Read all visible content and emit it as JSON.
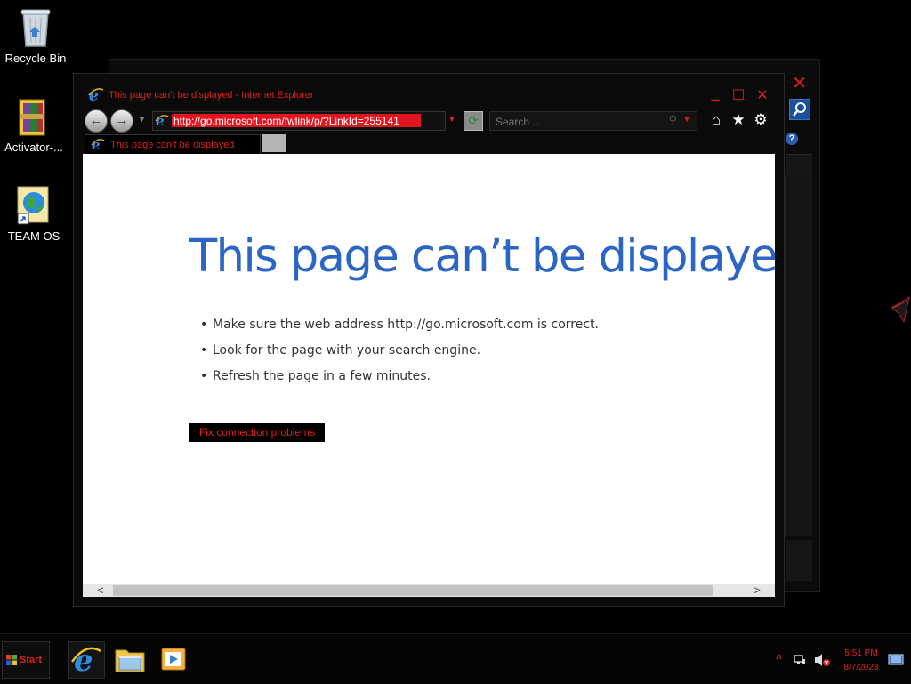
{
  "desktop": {
    "icons": [
      {
        "label": "Recycle Bin",
        "icon": "recycle-bin-icon"
      },
      {
        "label": "Activator-...",
        "icon": "winrar-archive-icon"
      },
      {
        "label": "TEAM OS",
        "icon": "globe-shortcut-icon"
      }
    ]
  },
  "browser": {
    "window_title": "This page can’t be displayed - Internet Explorer",
    "address": "http://go.microsoft.com/fwlink/p/?LinkId=255141",
    "search_placeholder": "Search ...",
    "tab_title": "This page can’t be displayed",
    "controls": {
      "minimize": "_",
      "maximize": "☐",
      "close": "✕"
    }
  },
  "error_page": {
    "heading": "This page can’t be displayed",
    "tips": [
      "Make sure the web address http://go.microsoft.com is correct.",
      "Look for the page with your search engine.",
      "Refresh the page in a few minutes."
    ],
    "fix_button": "Fix connection problems"
  },
  "taskbar": {
    "start_label": "Start",
    "pinned": [
      "internet-explorer-icon",
      "file-explorer-icon",
      "media-player-icon"
    ],
    "time": "5:51 PM",
    "date": "8/7/2023"
  },
  "colors": {
    "accent_red": "#e02020",
    "heading_blue": "#2c66c4",
    "address_highlight": "#e0151f"
  }
}
